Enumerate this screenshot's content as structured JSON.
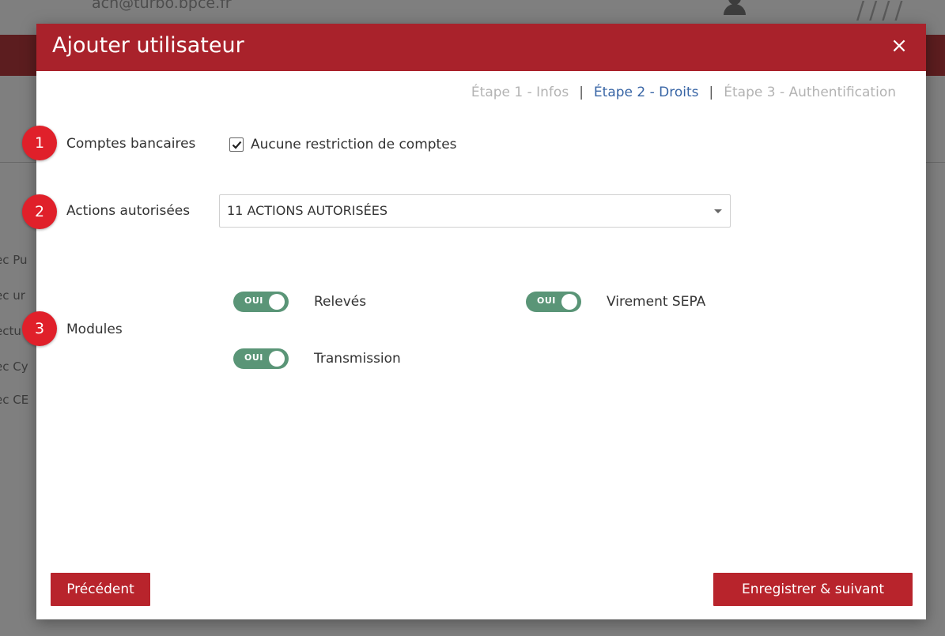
{
  "background": {
    "email": "ach@turbo.bpce.fr",
    "fragments": [
      "ec Pu",
      "ec ur",
      "ectu",
      "ec Cy",
      "ec CE"
    ]
  },
  "modal": {
    "title": "Ajouter utilisateur",
    "close_glyph": "×",
    "steps": [
      {
        "label": "Étape 1 - Infos",
        "active": false
      },
      {
        "label": "Étape 2 - Droits",
        "active": true
      },
      {
        "label": "Étape 3 - Authentification",
        "active": false
      }
    ],
    "step_separator": "|",
    "accounts": {
      "label": "Comptes bancaires",
      "checkbox_label": "Aucune restriction de comptes",
      "checked": true
    },
    "actions": {
      "label": "Actions autorisées",
      "selected_value": "11 ACTIONS AUTORISÉES"
    },
    "modules": {
      "label": "Modules",
      "toggle_text": "OUI",
      "items": [
        {
          "label": "Relevés",
          "enabled": true
        },
        {
          "label": "Virement SEPA",
          "enabled": true
        },
        {
          "label": "Transmission",
          "enabled": true
        }
      ]
    },
    "buttons": {
      "previous": "Précédent",
      "save_next": "Enregistrer & suivant"
    }
  },
  "markers": [
    "1",
    "2",
    "3"
  ],
  "colors": {
    "header": "#a9222b",
    "button": "#b8242c",
    "toggle_on": "#5a9577",
    "active_step": "#3865a5",
    "marker": "#e0202a"
  }
}
